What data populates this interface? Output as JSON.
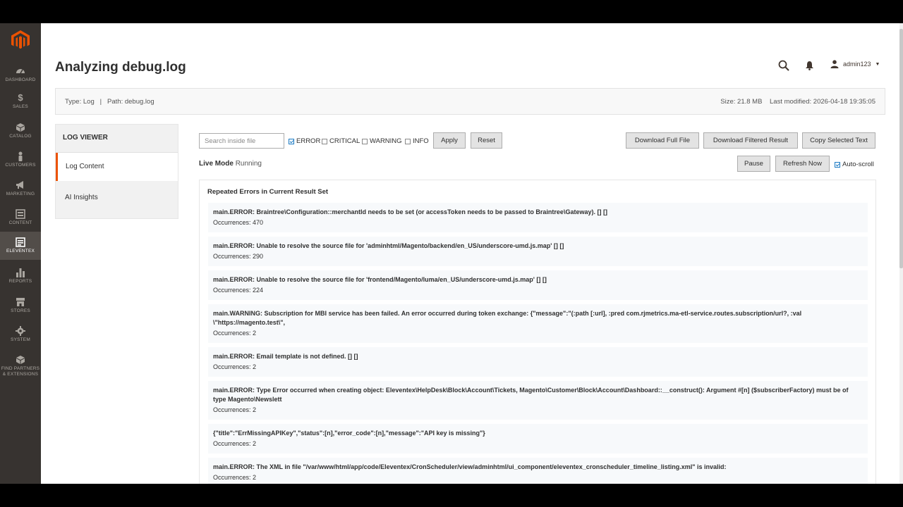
{
  "page": {
    "title": "Analyzing debug.log"
  },
  "header": {
    "user": "admin123"
  },
  "sidebar": {
    "items": [
      {
        "label": "DASHBOARD",
        "icon": "dashboard-icon"
      },
      {
        "label": "SALES",
        "icon": "dollar-icon"
      },
      {
        "label": "CATALOG",
        "icon": "box-icon"
      },
      {
        "label": "CUSTOMERS",
        "icon": "person-icon"
      },
      {
        "label": "MARKETING",
        "icon": "megaphone-icon"
      },
      {
        "label": "CONTENT",
        "icon": "layout-icon"
      },
      {
        "label": "ELEVENTEX",
        "icon": "eleventex-icon"
      },
      {
        "label": "REPORTS",
        "icon": "bar-chart-icon"
      },
      {
        "label": "STORES",
        "icon": "store-icon"
      },
      {
        "label": "SYSTEM",
        "icon": "gear-icon"
      },
      {
        "label": "FIND PARTNERS",
        "label2": "& EXTENSIONS",
        "icon": "partners-icon"
      }
    ]
  },
  "info": {
    "type": "Type: Log",
    "separator": "|",
    "path": "Path: debug.log",
    "size": "Size: 21.8 MB",
    "modified": "Last modified: 2026-04-18 19:35:05"
  },
  "panel": {
    "heading": "LOG VIEWER",
    "items": [
      "Log Content",
      "AI Insights"
    ]
  },
  "toolbar": {
    "search_placeholder": "Search inside file",
    "filters": [
      {
        "label": "ERROR",
        "checked": true
      },
      {
        "label": "CRITICAL",
        "checked": false
      },
      {
        "label": "WARNING",
        "checked": false
      },
      {
        "label": "INFO",
        "checked": false
      }
    ],
    "apply": "Apply",
    "reset": "Reset",
    "download_full": "Download Full File",
    "download_filtered": "Download Filtered Result",
    "copy_selected": "Copy Selected Text",
    "pause": "Pause",
    "refresh": "Refresh Now",
    "autoscroll": "Auto-scroll"
  },
  "live": {
    "label": "Live Mode",
    "status": "Running"
  },
  "results": {
    "title": "Repeated Errors in Current Result Set",
    "entries": [
      {
        "message": "main.ERROR: Braintree\\Configuration::merchantId needs to be set (or accessToken needs to be passed to Braintree\\Gateway). [] []",
        "occurrences": "Occurrences: 470"
      },
      {
        "message": "main.ERROR: Unable to resolve the source file for 'adminhtml/Magento/backend/en_US/underscore-umd.js.map' [] []",
        "occurrences": "Occurrences: 290"
      },
      {
        "message": "main.ERROR: Unable to resolve the source file for 'frontend/Magento/luma/en_US/underscore-umd.js.map' [] []",
        "occurrences": "Occurrences: 224"
      },
      {
        "message": "main.WARNING: Subscription for MBI service has been failed. An error occurred during token exchange: {\"message\":\"(:path [:url], :pred com.rjmetrics.ma-etl-service.routes.subscription/url?, :val \\\"https://magento.test\\\",",
        "occurrences": "Occurrences: 2"
      },
      {
        "message": "main.ERROR: Email template is not defined. [] []",
        "occurrences": "Occurrences: 2"
      },
      {
        "message": "main.ERROR: Type Error occurred when creating object: Eleventex\\HelpDesk\\Block\\Account\\Tickets, Magento\\Customer\\Block\\Account\\Dashboard::__construct(): Argument #[n] ($subscriberFactory) must be of type Magento\\Newslett",
        "occurrences": "Occurrences: 2"
      },
      {
        "message": "{\"title\":\"ErrMissingAPIKey\",\"status\":[n],\"error_code\":[n],\"message\":\"API key is missing\"}",
        "occurrences": "Occurrences: 2"
      },
      {
        "message": "main.ERROR: The XML in file \"/var/www/html/app/code/Eleventex/CronScheduler/view/adminhtml/ui_component/eleventex_cronscheduler_timeline_listing.xml\" is invalid:",
        "occurrences": "Occurrences: 2"
      }
    ]
  },
  "colors": {
    "sidebar": "#373330",
    "accent": "#eb5202"
  }
}
